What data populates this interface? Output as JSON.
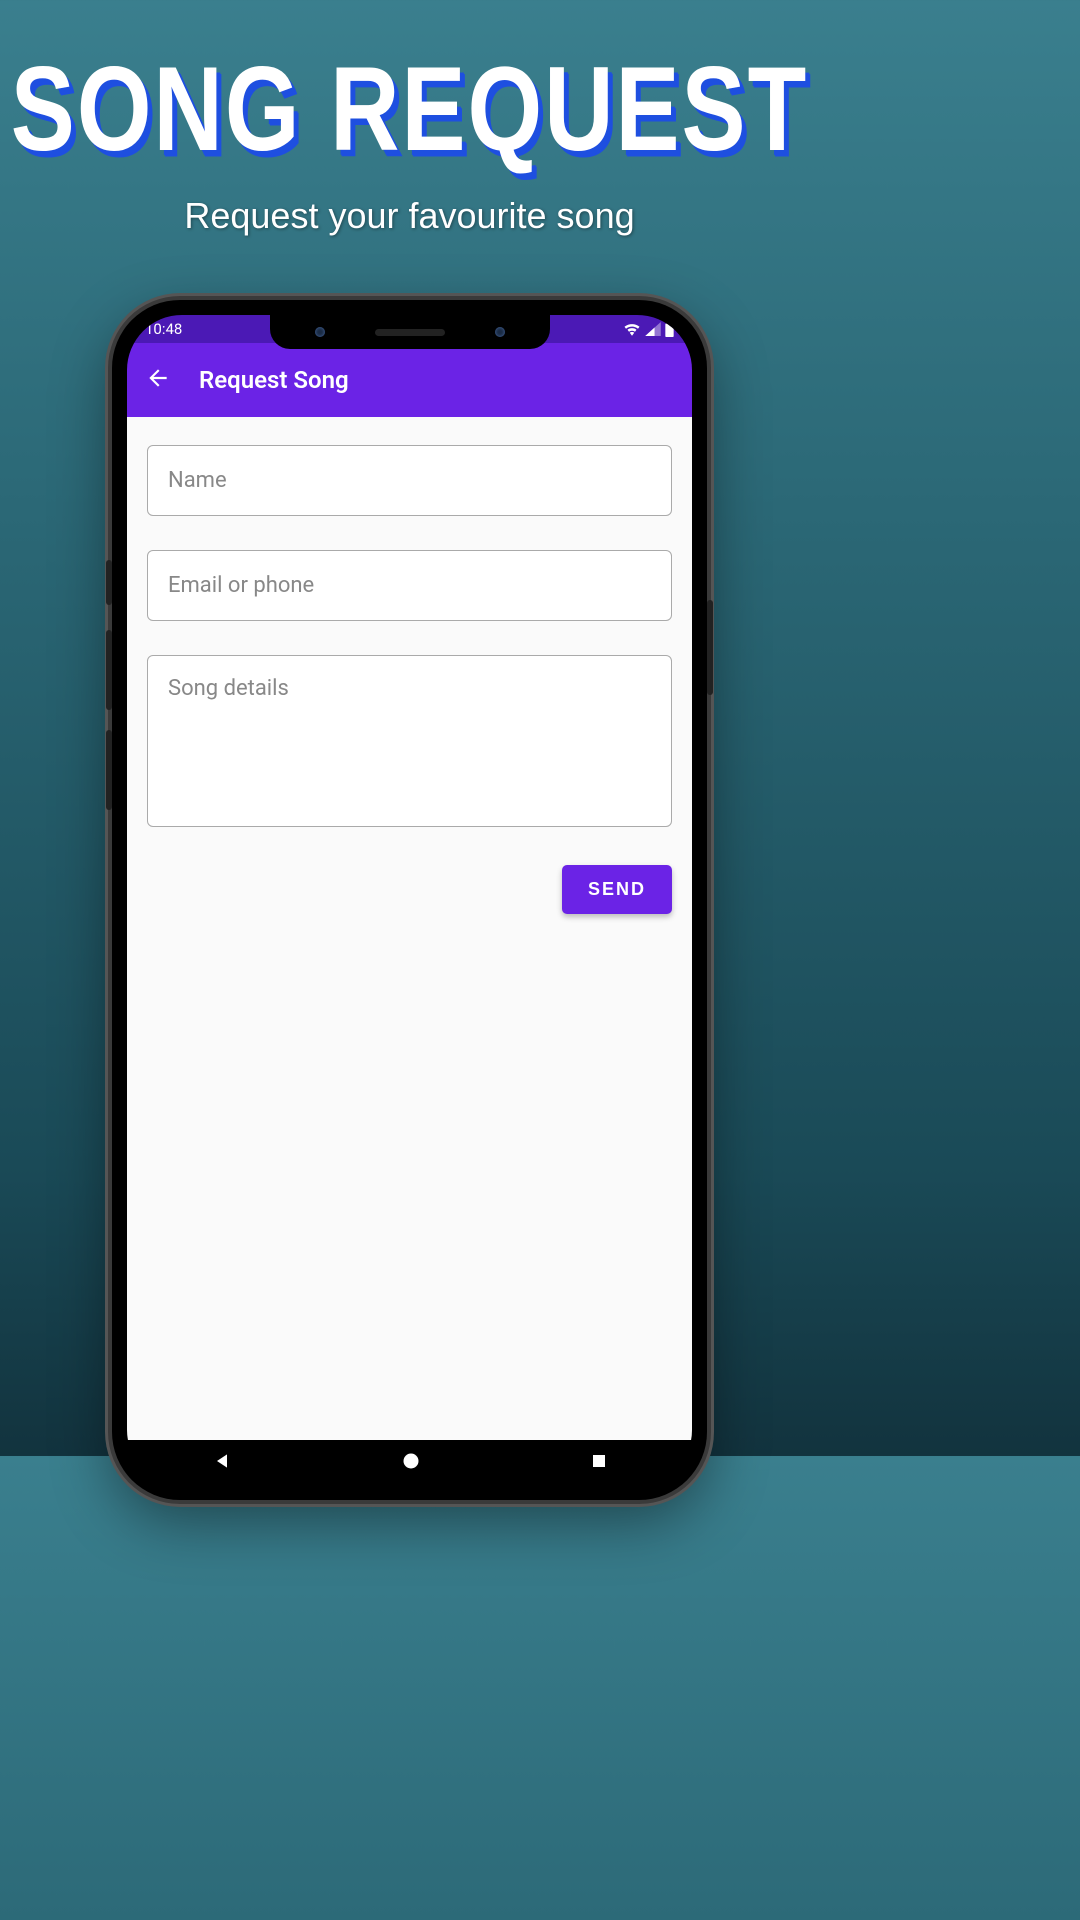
{
  "promo": {
    "title": "SONG REQUEST",
    "subtitle": "Request your favourite song"
  },
  "status": {
    "time": "10:48"
  },
  "appbar": {
    "title": "Request Song"
  },
  "form": {
    "name_placeholder": "Name",
    "contact_placeholder": "Email or phone",
    "details_placeholder": "Song details",
    "send_label": "SEND"
  }
}
